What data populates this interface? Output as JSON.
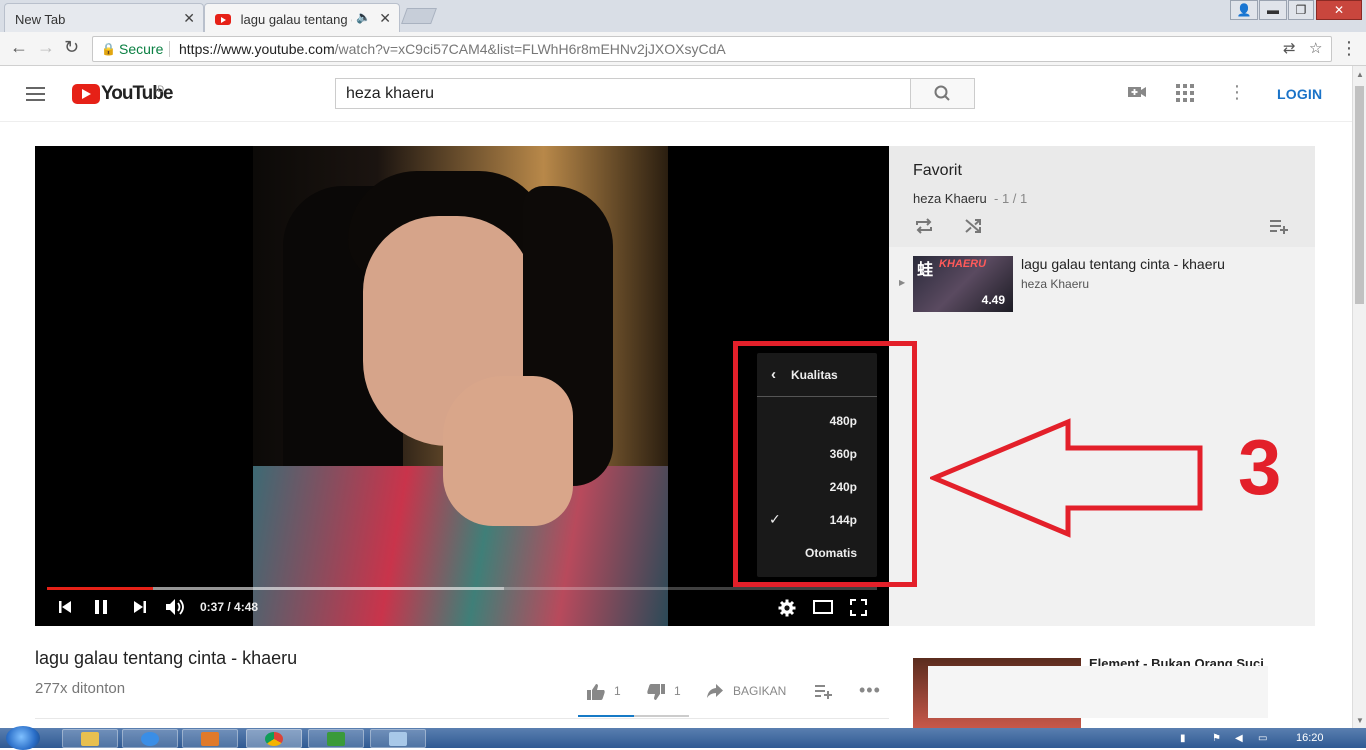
{
  "browser": {
    "tabs": [
      {
        "label": "New Tab",
        "close": "✕"
      },
      {
        "label": "lagu galau tentang ci",
        "close": "✕"
      }
    ],
    "window_controls": {
      "minimize": "▬",
      "maximize": "▭",
      "restore": "❐",
      "close": "✕"
    },
    "secure_label": "Secure",
    "url_host": "https://www.youtube.com",
    "url_rest": "/watch?v=xC9ci57CAM4&list=FLWhH6r8mEHNv2jJXOXsyCdA"
  },
  "youtube": {
    "logo_text": "YouTube",
    "region": "ID",
    "search_value": "heza khaeru",
    "login_label": "LOGIN"
  },
  "player": {
    "time": "0:37 / 4:48",
    "played_fraction": 0.128,
    "loaded_fraction": 0.55,
    "quality_menu": {
      "title": "Kualitas",
      "options": [
        "480p",
        "360p",
        "240p",
        "144p",
        "Otomatis"
      ],
      "selected": "144p"
    }
  },
  "annotation": {
    "number": "3",
    "color": "#e3202a"
  },
  "playlist": {
    "title": "Favorit",
    "owner": "heza Khaeru",
    "count": "- 1 / 1",
    "item": {
      "title": "lagu galau tentang cinta - khaeru",
      "owner": "heza Khaeru",
      "duration": "4.49",
      "thumb_text": "KHAERU"
    }
  },
  "video": {
    "title": "lagu galau tentang cinta - khaeru",
    "views": "277x ditonton",
    "likes": "1",
    "dislikes": "1",
    "share_label": "BAGIKAN"
  },
  "recommendation": {
    "title": "Element - Bukan Orang Suci"
  },
  "taskbar": {
    "time": "16:20"
  },
  "colors": {
    "accent": "#e62117",
    "link": "#1a73c8",
    "like_bar": "#167ac6"
  }
}
